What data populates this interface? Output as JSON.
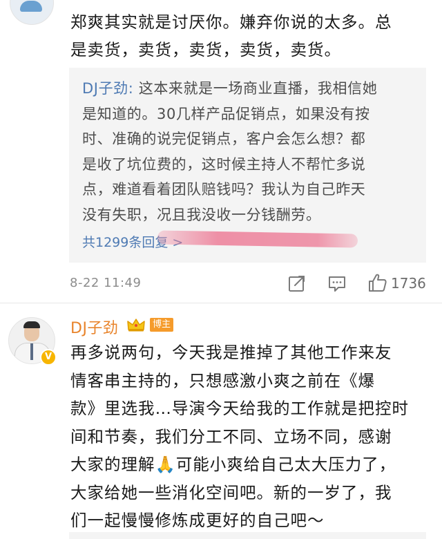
{
  "comment1": {
    "text_lines": [
      "郑爽其实就是讨厌你。嫌弃你说的太多。总",
      "是卖货，卖货，卖货，卖货，卖货。"
    ],
    "reply": {
      "author": "DJ子劲",
      "separator": ": ",
      "text_lines": [
        "这本来就是一场商业直播，我相信她",
        "是知道的。30几样产品促销点，如果没有按",
        "时、准确的说完促销点，客户会怎么想？都",
        "是收了坑位费的，这时候主持人不帮忙多说",
        "点，难道看着团队赔钱吗？我认为自己昨天",
        "没有失职，况且我没收一分钱酬劳。"
      ],
      "total_replies": "共1299条回复 >"
    },
    "timestamp": "8-22 11:49",
    "like_count": "1736"
  },
  "comment2": {
    "author": "DJ子劲",
    "author_badge": "博主",
    "text_lines": [
      "再多说两句，今天我是推掉了其他工作来友",
      "情客串主持的，只想感激小爽之前在《爆",
      "款》里选我…导演今天给我的工作就是把控时",
      "间和节奏，我们分工不同、立场不同，感谢",
      "大家的理解🙏可能小爽给自己太大压力了，",
      "大家给她一些消化空间吧。新的一岁了，我",
      "们一起慢慢修炼成更好的自己吧～"
    ]
  },
  "colors": {
    "author_orange": "#e8832a",
    "link_blue": "#4e7ab3",
    "reply_bg": "#f4f4f4",
    "badge_orange": "#f59b2b",
    "verified_gold": "#f7b500"
  },
  "icons": {
    "share": "share-icon",
    "comment": "comment-icon",
    "like": "thumbs-up-icon",
    "crown": "crown-icon",
    "verified": "verified-badge-icon"
  }
}
